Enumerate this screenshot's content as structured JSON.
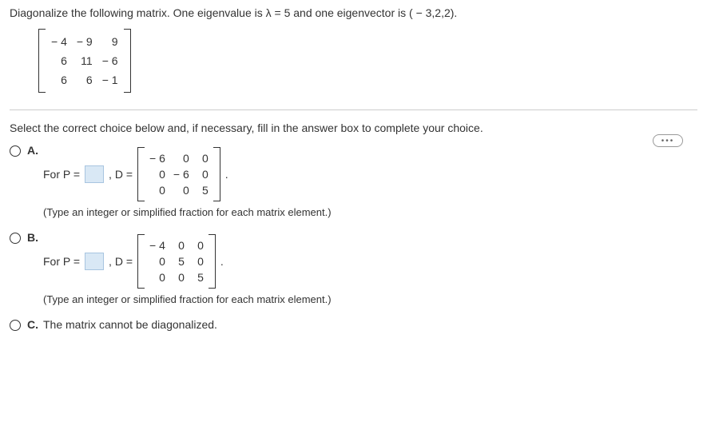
{
  "question": "Diagonalize the following matrix. One eigenvalue is λ = 5 and one eigenvector is ( − 3,2,2).",
  "matrix_A": [
    [
      "− 4",
      "− 9",
      "9"
    ],
    [
      "6",
      "11",
      "− 6"
    ],
    [
      "6",
      "6",
      "− 1"
    ]
  ],
  "instruction": "Select the correct choice below and, if necessary, fill in the answer box to complete your choice.",
  "choices": {
    "A": {
      "label": "A.",
      "prefix": "For P =",
      "mid": ", D =",
      "matrix": [
        [
          "− 6",
          "0",
          "0"
        ],
        [
          "0",
          "− 6",
          "0"
        ],
        [
          "0",
          "0",
          "5"
        ]
      ],
      "suffix": ".",
      "hint": "(Type an integer or simplified fraction for each matrix element.)"
    },
    "B": {
      "label": "B.",
      "prefix": "For P =",
      "mid": ", D =",
      "matrix": [
        [
          "− 4",
          "0",
          "0"
        ],
        [
          "0",
          "5",
          "0"
        ],
        [
          "0",
          "0",
          "5"
        ]
      ],
      "suffix": ".",
      "hint": "(Type an integer or simplified fraction for each matrix element.)"
    },
    "C": {
      "label": "C.",
      "text": "The matrix cannot be diagonalized."
    }
  },
  "ellipsis": "•••"
}
